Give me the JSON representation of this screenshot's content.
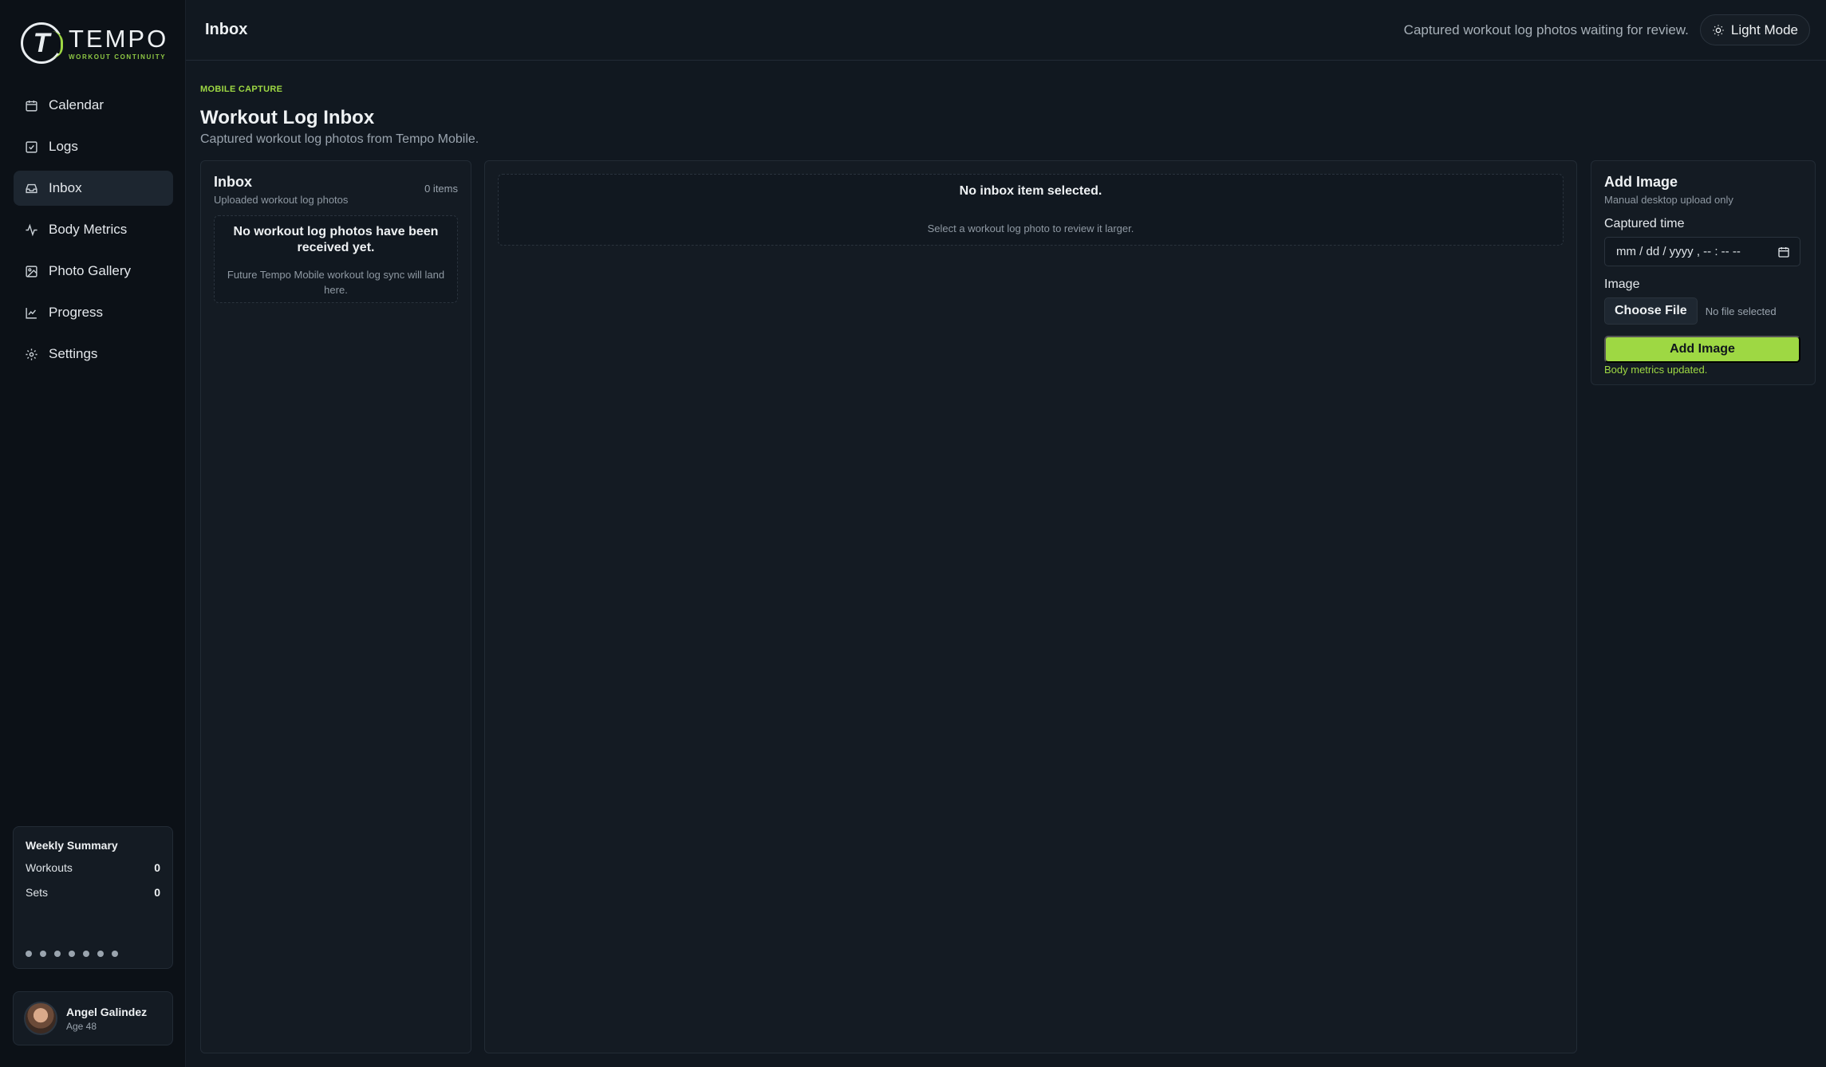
{
  "brand": {
    "name": "TEMPO",
    "tagline": "WORKOUT CONTINUITY"
  },
  "nav": [
    {
      "label": "Calendar",
      "icon": "calendar-icon"
    },
    {
      "label": "Logs",
      "icon": "check-square-icon"
    },
    {
      "label": "Inbox",
      "icon": "inbox-icon",
      "active": true
    },
    {
      "label": "Body Metrics",
      "icon": "activity-icon"
    },
    {
      "label": "Photo Gallery",
      "icon": "image-icon"
    },
    {
      "label": "Progress",
      "icon": "chart-icon"
    },
    {
      "label": "Settings",
      "icon": "gear-icon"
    }
  ],
  "weekly": {
    "title": "Weekly Summary",
    "workouts_label": "Workouts",
    "workouts_value": "0",
    "sets_label": "Sets",
    "sets_value": "0"
  },
  "user": {
    "name": "Angel Galindez",
    "age": "Age 48"
  },
  "topbar": {
    "title": "Inbox",
    "caption": "Captured workout log photos waiting for review.",
    "mode_label": "Light Mode"
  },
  "page": {
    "eyebrow": "MOBILE CAPTURE",
    "title": "Workout Log Inbox",
    "subtitle": "Captured workout log photos from Tempo Mobile."
  },
  "inbox": {
    "title": "Inbox",
    "subtitle": "Uploaded workout log photos",
    "count": "0 items",
    "empty_title": "No workout log photos have been received yet.",
    "empty_text": "Future Tempo Mobile workout log sync will land here."
  },
  "viewer": {
    "empty_title": "No inbox item selected.",
    "empty_text": "Select a workout log photo to review it larger."
  },
  "add": {
    "title": "Add Image",
    "subtitle": "Manual desktop upload only",
    "time_label": "Captured time",
    "time_value": "mm / dd / yyyy ,  -- : --   --",
    "image_label": "Image",
    "choose_label": "Choose File",
    "file_status": "No file selected",
    "button_label": "Add Image",
    "status_message": "Body metrics updated."
  },
  "colors": {
    "accent": "#9ed843",
    "background": "#111820",
    "sidebar": "#0c1117"
  }
}
